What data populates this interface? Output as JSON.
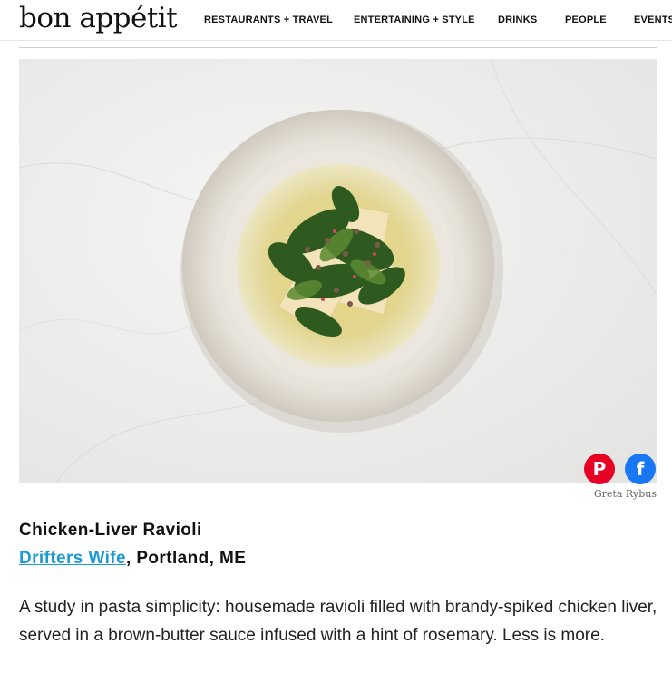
{
  "header": {
    "logo": "bon appétit",
    "nav": [
      "RESTAURANTS + TRAVEL",
      "ENTERTAINING + STYLE",
      "DRINKS",
      "PEOPLE",
      "EVENTS"
    ]
  },
  "photo": {
    "alt_icon": "plate-of-ravioli-image",
    "credit": "Greta Rybus"
  },
  "share": {
    "pinterest_glyph": "P",
    "facebook_glyph": "f"
  },
  "article": {
    "dish": "Chicken-Liver Ravioli",
    "restaurant": "Drifters Wife",
    "location": ", Portland, ME",
    "description": "A study in pasta simplicity: housemade ravioli filled with brandy-spiked chicken liver, served in a brown-butter sauce infused with a hint of rosemary. Less is more."
  },
  "colors": {
    "pinterest": "#e60023",
    "facebook": "#1877f2",
    "link": "#1a9bd7"
  }
}
